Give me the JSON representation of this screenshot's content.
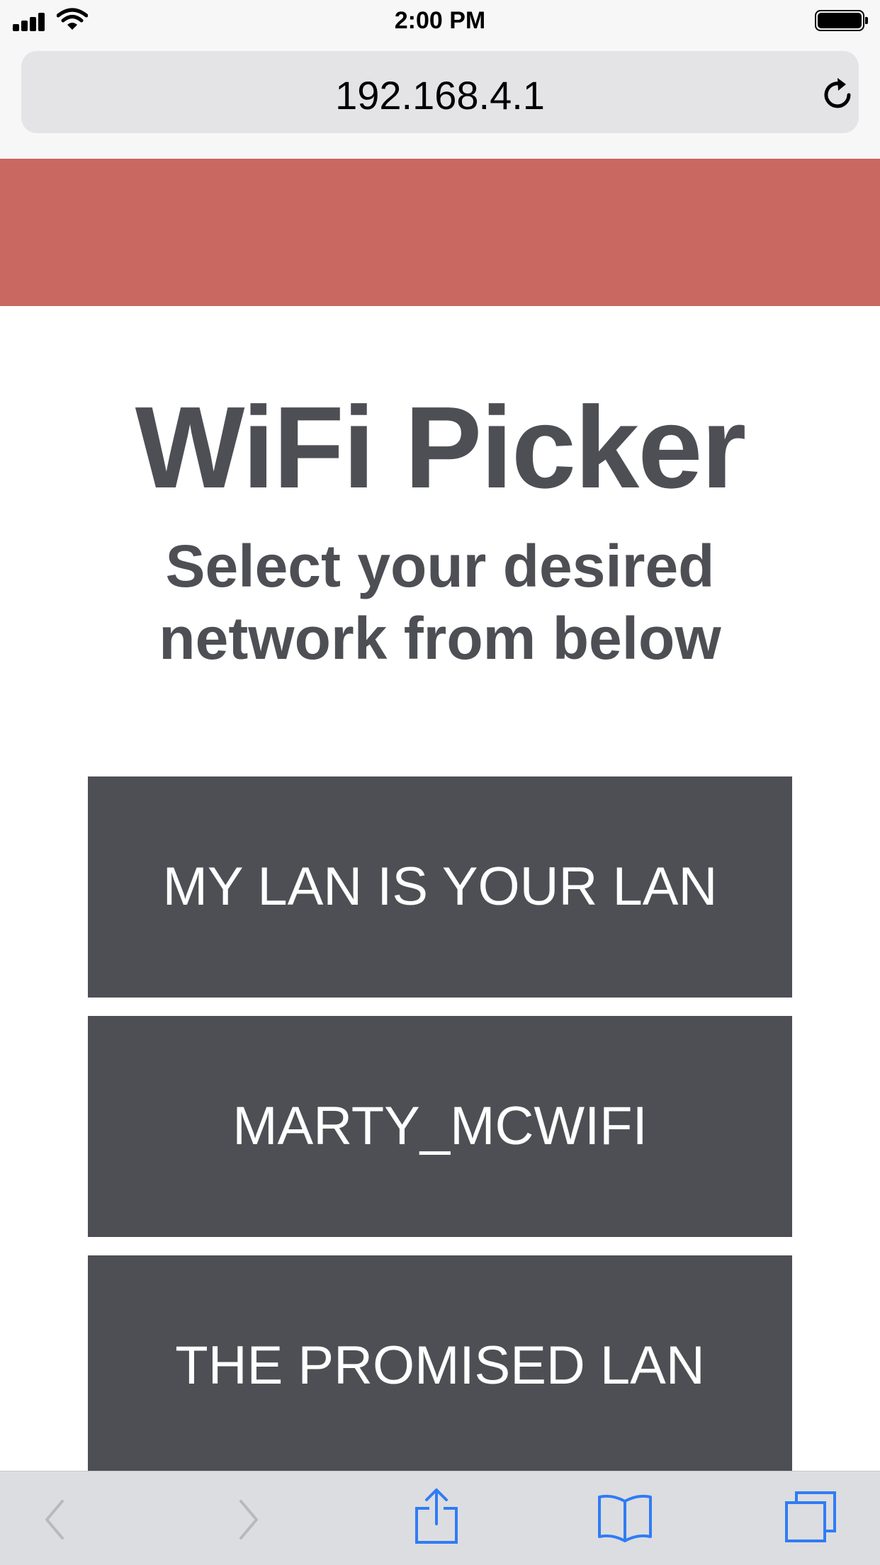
{
  "status_bar": {
    "time": "2:00 PM",
    "icons": [
      "signal-icon",
      "wifi-icon",
      "battery-icon"
    ]
  },
  "browser": {
    "url": "192.168.4.1",
    "reload_icon": "reload-icon",
    "toolbar_icons": [
      "back-icon",
      "forward-icon",
      "share-icon",
      "bookmarks-icon",
      "tabs-icon"
    ]
  },
  "page": {
    "banner_color": "#c96860",
    "title": "WiFi Picker",
    "subtitle": "Select your desired network from below",
    "networks": [
      {
        "label": "MY LAN IS YOUR LAN"
      },
      {
        "label": "MARTY_MCWIFI"
      },
      {
        "label": "THE PROMISED LAN"
      }
    ]
  },
  "colors": {
    "text_dark": "#4e4f54",
    "button_bg": "#4e4f54",
    "accent_blue": "#2f7cf6"
  }
}
